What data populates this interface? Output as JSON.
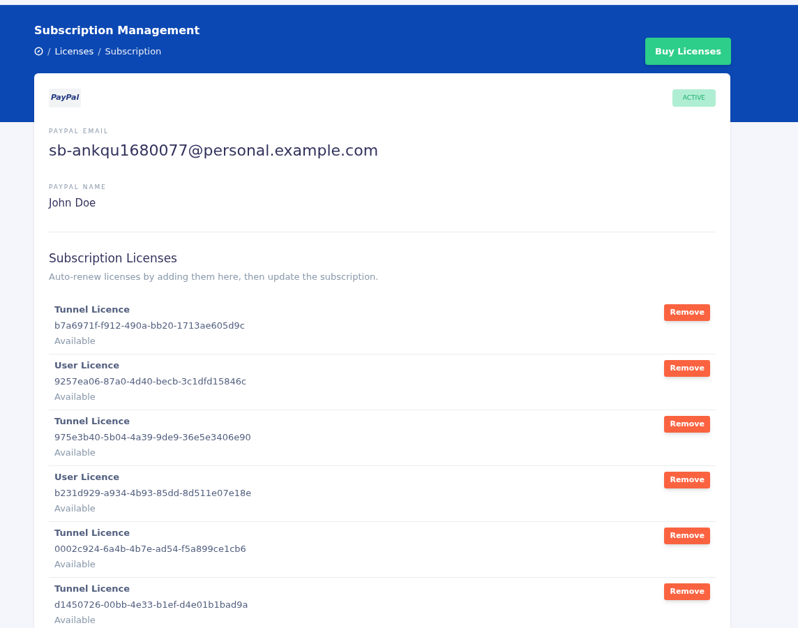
{
  "header": {
    "title": "Subscription Management",
    "breadcrumb": [
      {
        "separator": "/",
        "label": "Licenses"
      },
      {
        "separator": "/",
        "label": "Subscription"
      }
    ],
    "buy_button": "Buy Licenses"
  },
  "payment": {
    "provider_logo": "PayPal",
    "status": "ACTIVE",
    "fields": [
      {
        "label": "PAYPAL EMAIL",
        "value": "sb-ankqu1680077@personal.example.com",
        "kind": "large"
      },
      {
        "label": "PAYPAL NAME",
        "value": "John Doe",
        "kind": "normal"
      }
    ]
  },
  "licenses": {
    "title": "Subscription Licenses",
    "subtitle": "Auto-renew licenses by adding them here, then update the subscription.",
    "items": [
      {
        "name": "Tunnel Licence",
        "key": "b7a6971f-f912-490a-bb20-1713ae605d9c",
        "status": "Available",
        "action": "Remove"
      },
      {
        "name": "User Licence",
        "key": "9257ea06-87a0-4d40-becb-3c1dfd15846c",
        "status": "Available",
        "action": "Remove"
      },
      {
        "name": "Tunnel Licence",
        "key": "975e3b40-5b04-4a39-9de9-36e5e3406e90",
        "status": "Available",
        "action": "Remove"
      },
      {
        "name": "User Licence",
        "key": "b231d929-a934-4b93-85dd-8d511e07e18e",
        "status": "Available",
        "action": "Remove"
      },
      {
        "name": "Tunnel Licence",
        "key": "0002c924-6a4b-4b7e-ad54-f5a899ce1cb6",
        "status": "Available",
        "action": "Remove"
      },
      {
        "name": "Tunnel Licence",
        "key": "d1450726-00bb-4e33-b1ef-d4e01b1bad9a",
        "status": "Available",
        "action": "Remove"
      }
    ]
  }
}
